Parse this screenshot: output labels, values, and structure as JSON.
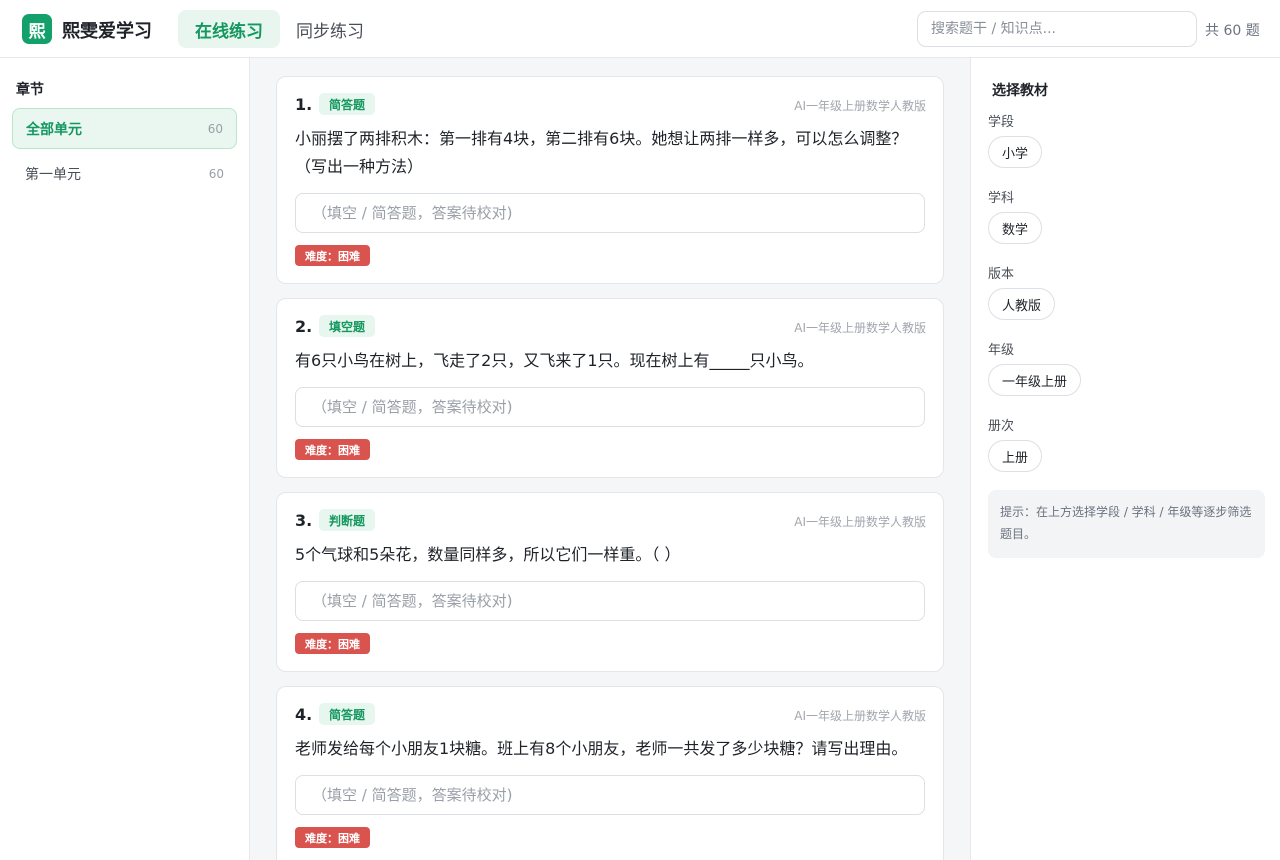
{
  "app": {
    "logo_char": "熙",
    "name": "熙雯爱学习",
    "accent": "#14a06a"
  },
  "nav": {
    "tabs": [
      {
        "label": "在线练习",
        "active": true
      },
      {
        "label": "同步练习",
        "active": false
      }
    ]
  },
  "search": {
    "placeholder": "搜索题干 / 知识点..."
  },
  "total_label": "共 60 题",
  "sidebar": {
    "title": "章节",
    "items": [
      {
        "label": "全部单元",
        "count": "60",
        "active": true
      },
      {
        "label": "第一单元",
        "count": "60",
        "active": false
      }
    ]
  },
  "questions": [
    {
      "num": "1.",
      "type": "简答题",
      "source": "AI一年级上册数学人教版",
      "text": "小丽摆了两排积木：第一排有4块，第二排有6块。她想让两排一样多，可以怎么调整？（写出一种方法）",
      "answer_placeholder": "（填空 / 简答题，答案待校对)",
      "difficulty": "难度：困难"
    },
    {
      "num": "2.",
      "type": "填空题",
      "source": "AI一年级上册数学人教版",
      "text": "有6只小鸟在树上，飞走了2只，又飞来了1只。现在树上有_____只小鸟。",
      "answer_placeholder": "（填空 / 简答题，答案待校对)",
      "difficulty": "难度：困难"
    },
    {
      "num": "3.",
      "type": "判断题",
      "source": "AI一年级上册数学人教版",
      "text": "5个气球和5朵花，数量同样多，所以它们一样重。（ ）",
      "answer_placeholder": "（填空 / 简答题，答案待校对)",
      "difficulty": "难度：困难"
    },
    {
      "num": "4.",
      "type": "简答题",
      "source": "AI一年级上册数学人教版",
      "text": "老师发给每个小朋友1块糖。班上有8个小朋友，老师一共发了多少块糖？请写出理由。",
      "answer_placeholder": "（填空 / 简答题，答案待校对)",
      "difficulty": "难度：困难"
    }
  ],
  "filters": {
    "title": "选择教材",
    "groups": [
      {
        "label": "学段",
        "value": "小学"
      },
      {
        "label": "学科",
        "value": "数学"
      },
      {
        "label": "版本",
        "value": "人教版"
      },
      {
        "label": "年级",
        "value": "一年级上册"
      },
      {
        "label": "册次",
        "value": "上册"
      }
    ],
    "hint": "提示：在上方选择学段 / 学科 / 年级等逐步筛选题目。"
  }
}
